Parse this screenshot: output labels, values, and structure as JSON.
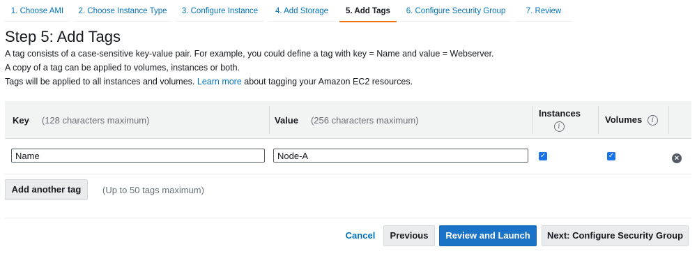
{
  "steps": [
    {
      "label": "1. Choose AMI"
    },
    {
      "label": "2. Choose Instance Type"
    },
    {
      "label": "3. Configure Instance"
    },
    {
      "label": "4. Add Storage"
    },
    {
      "label": "5. Add Tags",
      "active": true
    },
    {
      "label": "6. Configure Security Group"
    },
    {
      "label": "7. Review"
    }
  ],
  "page": {
    "title": "Step 5: Add Tags",
    "desc_line1": "A tag consists of a case-sensitive key-value pair. For example, you could define a tag with key = Name and value = Webserver.",
    "desc_line2": "A copy of a tag can be applied to volumes, instances or both.",
    "desc_line3_pre": "Tags will be applied to all instances and volumes.",
    "learn_more": "Learn more",
    "desc_line3_post": "about tagging your Amazon EC2 resources."
  },
  "table": {
    "key_header": "Key",
    "key_hint": "(128 characters maximum)",
    "value_header": "Value",
    "value_hint": "(256 characters maximum)",
    "instances_header": "Instances",
    "volumes_header": "Volumes",
    "rows": [
      {
        "key": "Name",
        "value": "Node-A",
        "instances": true,
        "volumes": true
      }
    ]
  },
  "actions": {
    "add_tag": "Add another tag",
    "add_tag_hint": "(Up to 50 tags maximum)",
    "cancel": "Cancel",
    "previous": "Previous",
    "review_launch": "Review and Launch",
    "next": "Next: Configure Security Group"
  },
  "icons": {
    "info": "info-icon",
    "check": "checkbox-check-icon",
    "remove": "remove-circle-icon"
  },
  "colors": {
    "accent": "#ec7211",
    "primary": "#1a73c6",
    "link": "#0073bb"
  }
}
